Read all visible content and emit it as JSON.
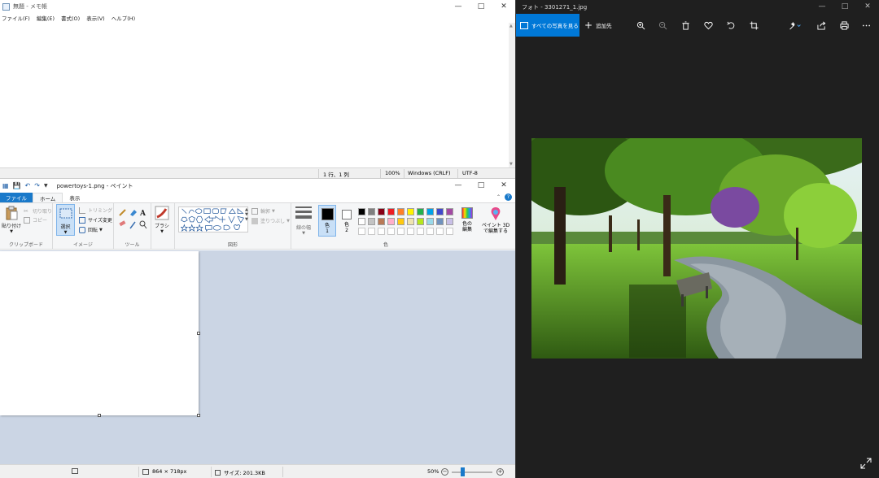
{
  "notepad": {
    "title": "無題 - メモ帳",
    "menu": [
      "ファイル(F)",
      "編集(E)",
      "書式(O)",
      "表示(V)",
      "ヘルプ(H)"
    ],
    "status": {
      "position": "1 行、1 列",
      "zoom": "100%",
      "line_ending": "Windows (CRLF)",
      "encoding": "UTF-8"
    }
  },
  "paint": {
    "title": "powertoys-1.png - ペイント",
    "tabs": {
      "file": "ファイル",
      "home": "ホーム",
      "view": "表示"
    },
    "clipboard": {
      "paste": "貼り付け",
      "cut": "切り取り",
      "copy": "コピー",
      "label": "クリップボード"
    },
    "image": {
      "select": "選択",
      "crop": "トリミング",
      "resize": "サイズ変更",
      "rotate": "回転",
      "label": "イメージ"
    },
    "tools": {
      "label": "ツール"
    },
    "brushes": {
      "label": "ブラシ"
    },
    "shapes": {
      "outline": "輪郭",
      "fill": "塗りつぶし",
      "label": "図形"
    },
    "size": {
      "label": "線の幅"
    },
    "colors": {
      "color1": "色\n1",
      "color2": "色\n2",
      "edit": "色の\n編集",
      "label": "色",
      "color1_value": "#000000",
      "color2_value": "#ffffff",
      "palette_row1": [
        "#000000",
        "#7f7f7f",
        "#880015",
        "#ed1c24",
        "#ff7f27",
        "#fff200",
        "#22b14c",
        "#00a2e8",
        "#3f48cc",
        "#a349a4"
      ],
      "palette_row2": [
        "#ffffff",
        "#c3c3c3",
        "#b97a57",
        "#ffaec9",
        "#ffc90e",
        "#efe4b0",
        "#b5e61d",
        "#99d9ea",
        "#7092be",
        "#c8bfe7"
      ]
    },
    "paint3d": "ペイント 3D\nで編集する",
    "status": {
      "dimensions": "864 × 718px",
      "size": "サイズ: 201.3KB",
      "zoom": "50%"
    }
  },
  "photos": {
    "title": "フォト - 3301271_1.jpg",
    "toolbar": {
      "all_photos": "すべての写真を見る",
      "add_to": "追加先"
    },
    "icons": [
      "zoom-in-icon",
      "zoom-out-icon",
      "delete-icon",
      "heart-icon",
      "rotate-icon",
      "crop-icon",
      "edit-icon",
      "share-icon",
      "print-icon",
      "more-icon"
    ]
  }
}
